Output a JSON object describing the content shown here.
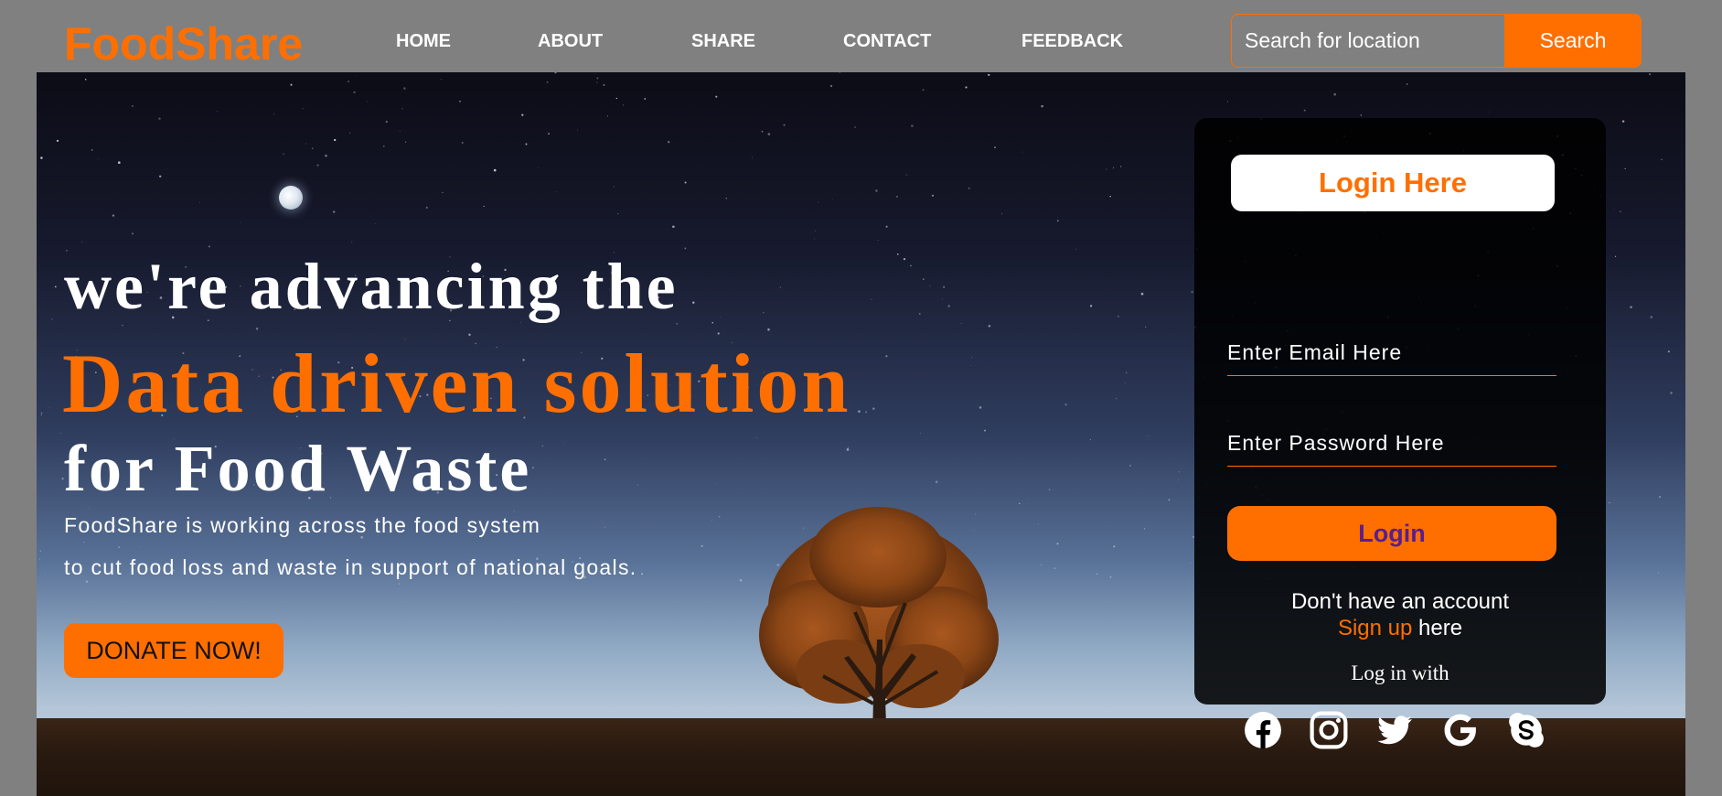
{
  "brand": {
    "name": "FoodShare",
    "accent_color": "#ff6f00"
  },
  "nav": {
    "items": [
      {
        "label": "HOME"
      },
      {
        "label": "ABOUT"
      },
      {
        "label": "SHARE"
      },
      {
        "label": "CONTACT"
      },
      {
        "label": "FEEDBACK"
      }
    ]
  },
  "search": {
    "placeholder": "Search for location",
    "button_label": "Search"
  },
  "hero": {
    "headline_line1": "we're advancing the",
    "headline_line2": "Data driven solution",
    "headline_line3": "for Food Waste",
    "description_line1": "FoodShare is working across the food system",
    "description_line2": "to cut food loss and waste in support of national goals.",
    "donate_label": "DONATE NOW!"
  },
  "login": {
    "title": "Login Here",
    "email_placeholder": "Enter Email Here",
    "password_placeholder": "Enter Password Here",
    "button_label": "Login",
    "no_account_text": "Don't have an account",
    "signup_link": "Sign up",
    "signup_suffix": " here",
    "login_with": "Log in with",
    "social_icons": [
      "facebook-icon",
      "instagram-icon",
      "twitter-icon",
      "google-icon",
      "skype-icon"
    ]
  }
}
